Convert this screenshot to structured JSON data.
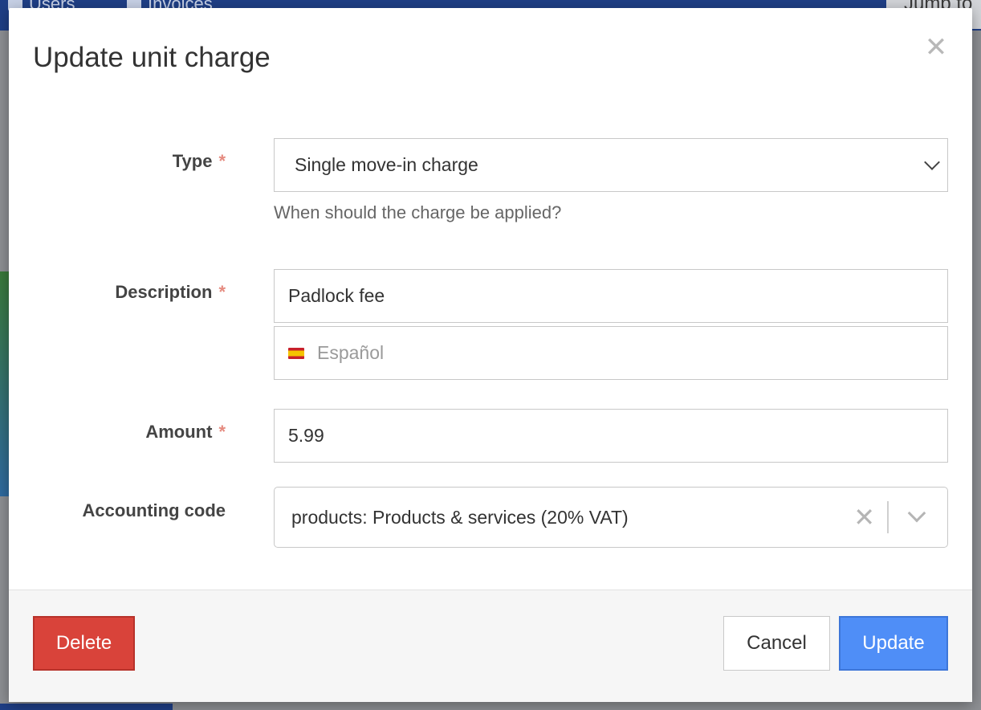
{
  "background": {
    "tabs": [
      {
        "label": "Users"
      },
      {
        "label": "Invoices"
      }
    ],
    "jump_label": "Jump to"
  },
  "modal": {
    "title": "Update unit charge",
    "close_icon": "close-icon",
    "fields": {
      "type": {
        "label": "Type",
        "required_marker": "*",
        "value": "Single move-in charge",
        "help": "When should the charge be applied?"
      },
      "description": {
        "label": "Description",
        "required_marker": "*",
        "value": "Padlock fee",
        "translation_placeholder": "Español",
        "translation_flag": "spain-flag-icon"
      },
      "amount": {
        "label": "Amount",
        "required_marker": "*",
        "value": "5.99"
      },
      "accounting_code": {
        "label": "Accounting code",
        "value": "products: Products & services (20% VAT)"
      }
    },
    "footer": {
      "delete_label": "Delete",
      "cancel_label": "Cancel",
      "update_label": "Update"
    }
  },
  "colors": {
    "delete": "#d9433a",
    "update": "#4f8ef7",
    "required": "#e58a7f"
  }
}
